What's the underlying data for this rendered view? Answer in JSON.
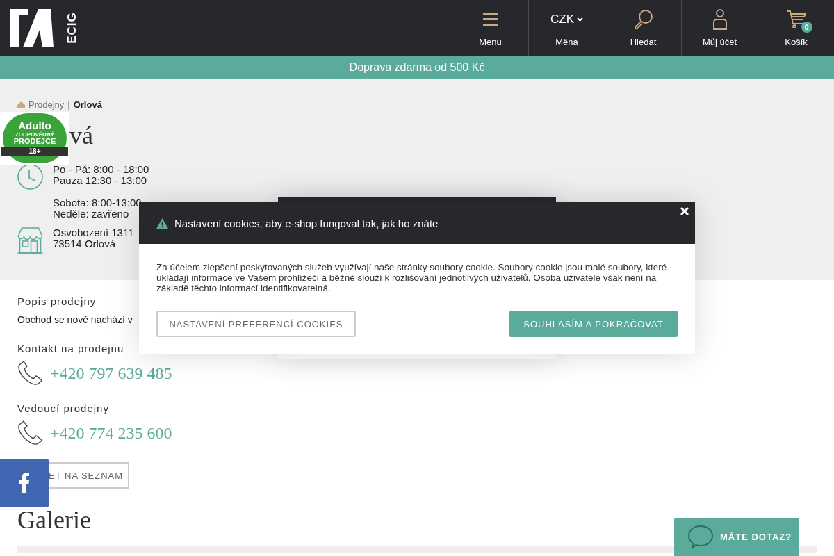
{
  "header": {
    "logo_text": "ECIG",
    "nav": [
      {
        "kind": "menu",
        "label": "Menu"
      },
      {
        "kind": "currency",
        "value": "CZK",
        "label": "Měna"
      },
      {
        "kind": "search",
        "label": "Hledat"
      },
      {
        "kind": "account",
        "label": "Můj účet"
      },
      {
        "kind": "cart",
        "label": "Košík",
        "badge": "0"
      }
    ]
  },
  "promo_bar": "Doprava zdarma od 500 Kč",
  "breadcrumb": [
    {
      "label": "Prodejny",
      "current": false
    },
    {
      "label": "Orlová",
      "current": true
    }
  ],
  "breadcrumb_separator": "|",
  "heading": "vá",
  "age_badge": {
    "brand": "Adulto",
    "line1": "ZODPOVĚDNÝ",
    "line2": "PRODEJCE",
    "age": "18+"
  },
  "store_info": [
    {
      "kind": "hours",
      "lines": [
        "Po - Pá: 8:00 - 18:00",
        "Pauza 12:30 - 13:00"
      ]
    },
    {
      "kind": "plain",
      "lines": [
        "Sobota: 8:00-13:00",
        "Neděle: zavřeno"
      ]
    },
    {
      "kind": "address",
      "lines": [
        "Osvobození 1311",
        "73514 Orlová"
      ]
    }
  ],
  "description": {
    "label": "Popis prodejny",
    "text": "Obchod se nově nachází v"
  },
  "contacts": [
    {
      "label": "Kontakt na prodejnu",
      "phone": "+420 797 639 485"
    },
    {
      "label": "Vedoucí prodejny",
      "phone": "+420 774 235 600"
    }
  ],
  "list_button": "ET NA SEZNAM",
  "gallery_title": "Galerie",
  "cookie_dialog": {
    "title": "Nastavení cookies, aby e-shop fungoval tak, jak ho znáte",
    "body": "Za účelem zlepšení poskytovaných služeb využívají naše stránky soubory cookie. Soubory cookie jsou malé soubory, které ukládají informace ve Vašem prohlížeči a běžně slouží k rozlišování jednotlivých uživatelů. Osoba uživatele však není na základě těchto informací identifikovatelná.",
    "buttons": [
      {
        "kind": "secondary",
        "label": "NASTAVENÍ PREFERENCÍ COOKIES"
      },
      {
        "kind": "primary",
        "label": "SOUHLASÍM A POKRAČOVAT"
      }
    ]
  },
  "chat_button": "MÁTE DOTAZ?"
}
